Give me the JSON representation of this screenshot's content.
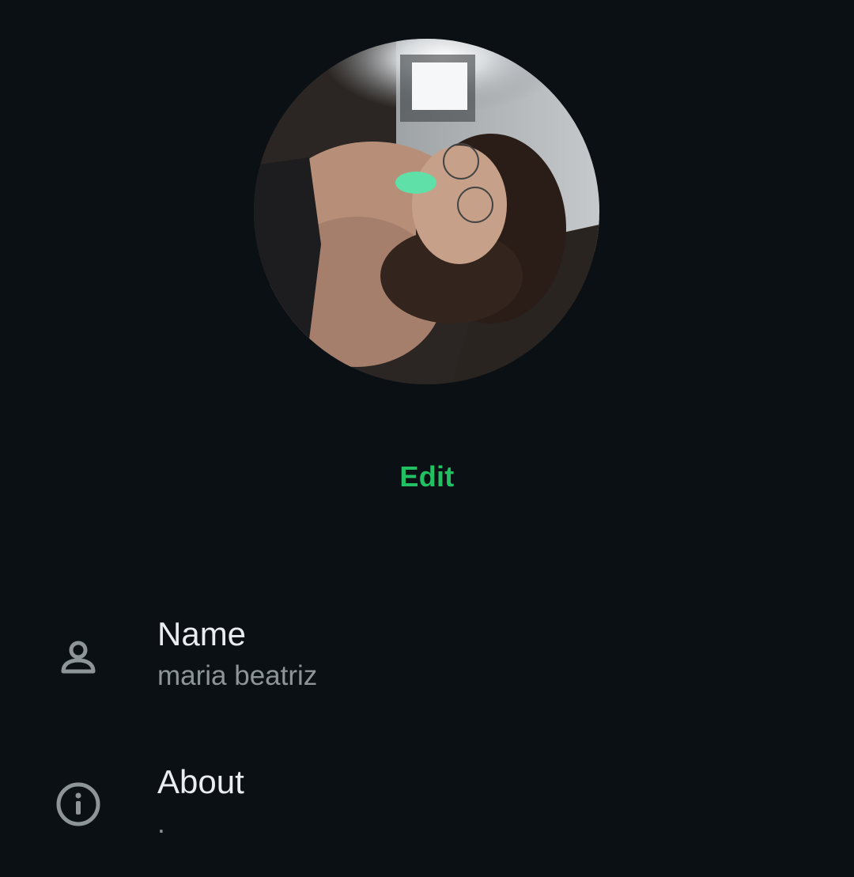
{
  "profile": {
    "photo_alt": "profile photo",
    "edit_label": "Edit"
  },
  "fields": {
    "name": {
      "icon": "person-icon",
      "label": "Name",
      "value": "maria beatriz"
    },
    "about": {
      "icon": "info-icon",
      "label": "About",
      "value": "."
    }
  },
  "colors": {
    "background": "#0b1014",
    "accent": "#21c063",
    "primary_text": "#e9edef",
    "secondary_text": "#8d9599",
    "icon": "#8d9599"
  }
}
